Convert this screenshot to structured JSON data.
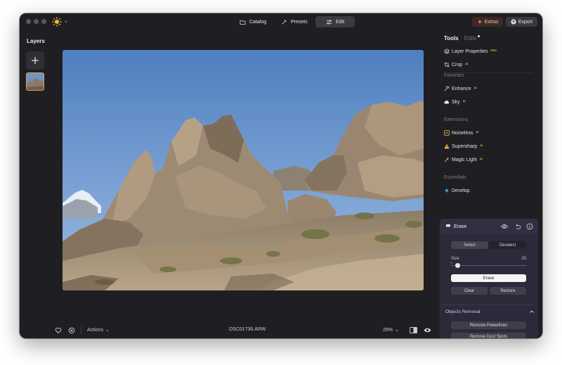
{
  "titlebar": {
    "tabs": [
      {
        "label": "Catalog",
        "active": false
      },
      {
        "label": "Presets",
        "active": false
      },
      {
        "label": "Edit",
        "active": true
      }
    ],
    "extras_label": "Extras",
    "export_label": "Export"
  },
  "layers": {
    "title": "Layers"
  },
  "bottombar": {
    "actions_label": "Actions",
    "filename": "DSC01736.ARW",
    "zoom": "29%"
  },
  "right_panel": {
    "tab_tools": "Tools",
    "tab_edits": "Edits",
    "tools": [
      {
        "label": "Layer Properties",
        "badge": "PRO",
        "icon": "layers-icon"
      },
      {
        "label": "Crop",
        "badge": "AI",
        "icon": "crop-icon"
      }
    ],
    "favorites_title": "Favorites",
    "favorites": [
      {
        "label": "Enhance",
        "badge": "AI",
        "icon": "enhance-icon"
      },
      {
        "label": "Sky",
        "badge": "AI",
        "icon": "cloud-icon"
      }
    ],
    "extensions_title": "Extensions",
    "extensions": [
      {
        "label": "Noiseless",
        "badge": "AI",
        "icon": "noiseless-icon"
      },
      {
        "label": "Supersharp",
        "badge": "AI",
        "icon": "supersharp-icon"
      },
      {
        "label": "Magic Light",
        "badge": "AI",
        "icon": "magic-light-icon"
      }
    ],
    "essentials_title": "Essentials",
    "essentials": [
      {
        "label": "Develop",
        "icon": "sun-icon"
      }
    ]
  },
  "erase": {
    "title": "Erase",
    "select_label": "Select",
    "deselect_label": "Deselect",
    "size_label": "Size",
    "size_value": "20",
    "size_fraction": 0.09,
    "erase_button": "Erase",
    "clear_button": "Clear",
    "restore_button": "Restore",
    "objects_removal_title": "Objects Removal",
    "remove_powerlines": "Remove Powerlines",
    "remove_dust_spots": "Remove Dust Spots"
  },
  "colors": {
    "window_bg": "#1f1f23",
    "accent_gold": "#e8b84a",
    "erase_panel": "#2c2a3a"
  }
}
